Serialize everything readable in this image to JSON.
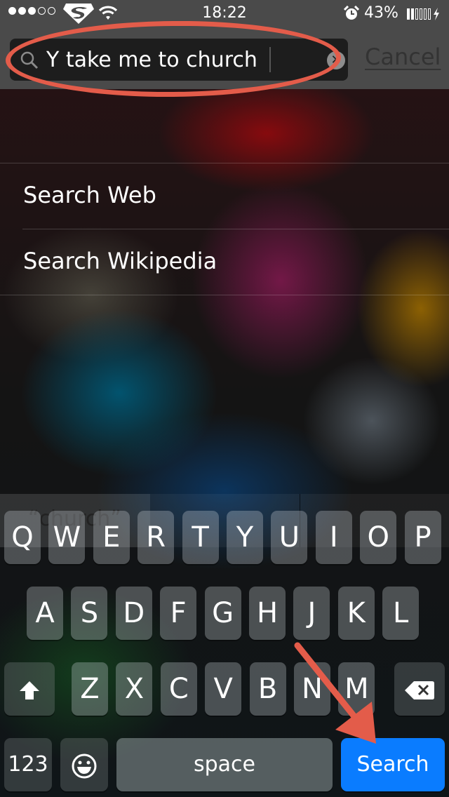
{
  "status_bar": {
    "signal_strength": {
      "filled": 3,
      "total": 5
    },
    "carrier_icon": "superman-logo-icon",
    "wifi_icon": "wifi-icon",
    "time": "18:22",
    "alarm_icon": "alarm-clock-icon",
    "battery_percent": "43%",
    "battery_level": {
      "filled": 2,
      "total": 6
    },
    "charging_icon": "lightning-bolt-icon"
  },
  "search": {
    "value": "Y take me to church",
    "icon": "search-icon",
    "clear_icon": "clear-x-icon",
    "clear_glyph": "✕",
    "cancel_label": "Cancel"
  },
  "results": [
    {
      "label": "Search Web"
    },
    {
      "label": "Search Wikipedia"
    }
  ],
  "keyboard": {
    "suggestion": "“church”",
    "row1": [
      "Q",
      "W",
      "E",
      "R",
      "T",
      "Y",
      "U",
      "I",
      "O",
      "P"
    ],
    "row2": [
      "A",
      "S",
      "D",
      "F",
      "G",
      "H",
      "J",
      "K",
      "L"
    ],
    "row3": [
      "Z",
      "X",
      "C",
      "V",
      "B",
      "N",
      "M"
    ],
    "shift_icon": "shift-arrow-icon",
    "backspace_icon": "backspace-icon",
    "numbers_label": "123",
    "emoji_icon": "emoji-smiley-icon",
    "space_label": "space",
    "search_label": "Search"
  },
  "annotations": {
    "color": "#e35c4a",
    "highlight": "ellipse around search field",
    "pointer": "arrow pointing to Search key"
  },
  "colors": {
    "search_key": "#0a7cff",
    "header_bg": "#4a4a4a",
    "search_field_bg": "#1d1d1d"
  }
}
